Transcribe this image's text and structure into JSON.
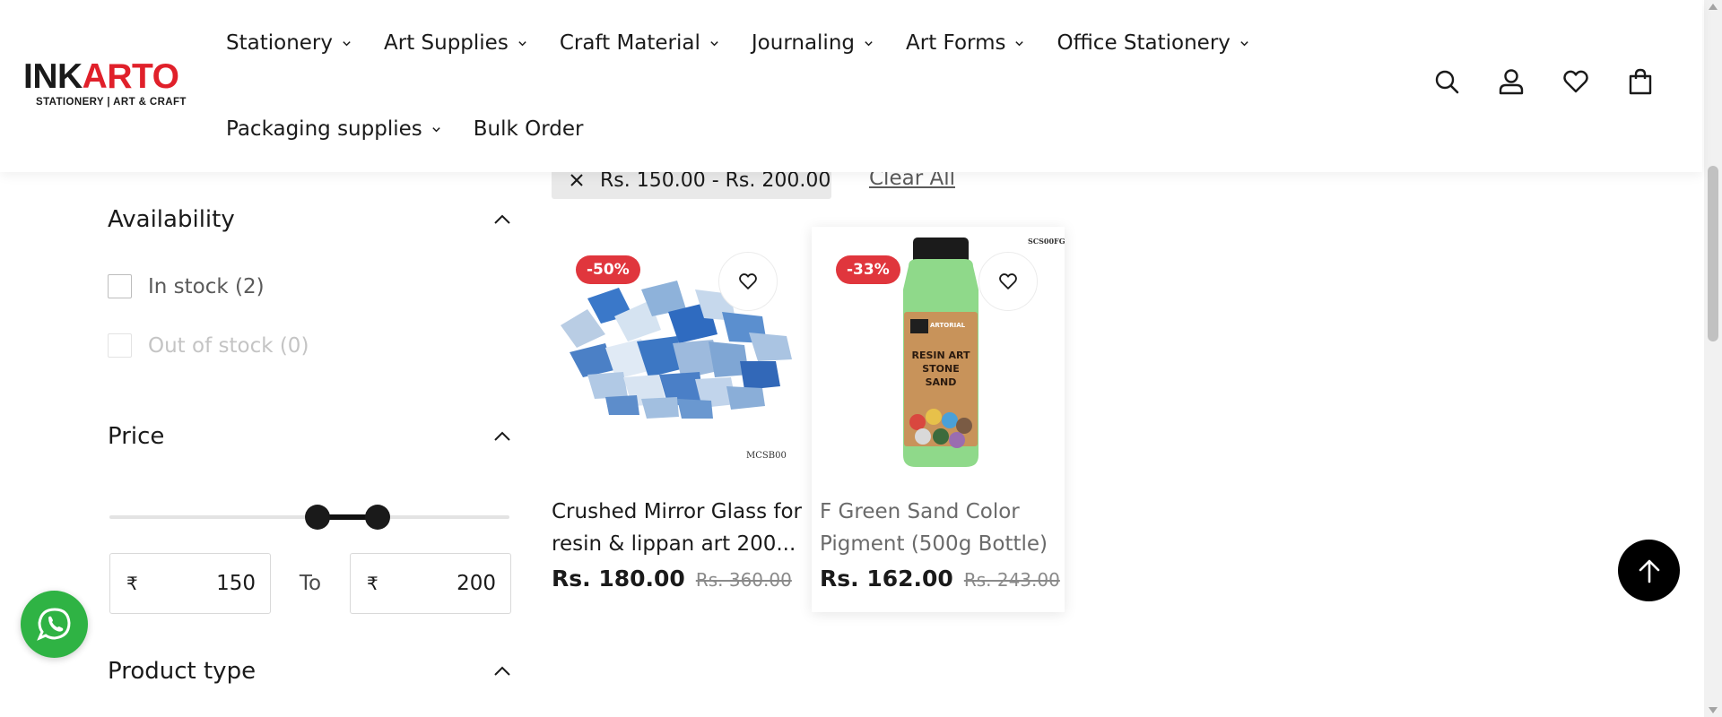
{
  "brand": {
    "logo_left": "INK",
    "logo_right": "ARTO",
    "tagline": "STATIONERY | ART & CRAFT"
  },
  "nav": {
    "row1": [
      "Stationery",
      "Art Supplies",
      "Craft Material",
      "Journaling",
      "Art Forms",
      "Office Stationery"
    ],
    "row2_dropdown": "Packaging supplies",
    "bulk_order": "Bulk Order"
  },
  "header_icons": [
    "search-icon",
    "account-icon",
    "wishlist-icon",
    "cart-icon"
  ],
  "filters": {
    "availability": {
      "title": "Availability",
      "in_stock": "In stock (2)",
      "out_of_stock": "Out of stock (0)"
    },
    "price": {
      "title": "Price",
      "currency": "₹",
      "min": "150",
      "max": "200",
      "to_label": "To",
      "range_fraction": {
        "low": 0.52,
        "high": 0.67
      }
    },
    "product_type": {
      "title": "Product type"
    }
  },
  "active_filter": {
    "label": "Rs. 150.00 - Rs. 200.00",
    "clear_all": "Clear All"
  },
  "products": [
    {
      "badge": "-50%",
      "title_line1": "Crushed Mirror Glass for",
      "title_line2": "resin & lippan art 200...",
      "price": "Rs. 180.00",
      "compare_price": "Rs. 360.00",
      "sku": "MCSB00"
    },
    {
      "badge": "-33%",
      "title_line1": "F Green Sand Color",
      "title_line2": "Pigment (500g Bottle)",
      "price": "Rs. 162.00",
      "compare_price": "Rs. 243.00",
      "sku": "SCS00FG",
      "label_brand": "ARTORIAL",
      "label_text": [
        "RESIN ART",
        "STONE",
        "SAND"
      ]
    }
  ],
  "colors": {
    "badge": "#e0363d",
    "brand_red": "#e0202a",
    "whatsapp": "#2fb344",
    "text": "#1a1a1a"
  }
}
